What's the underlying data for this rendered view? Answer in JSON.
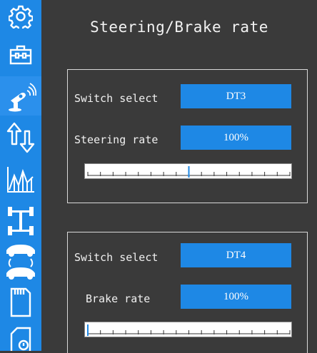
{
  "title": "Steering/Brake rate",
  "sidebar": {
    "items": [
      {
        "icon": "gear-icon"
      },
      {
        "icon": "toolbox-icon"
      },
      {
        "icon": "transmitter-icon",
        "active": true
      },
      {
        "icon": "reverse-arrows-icon"
      },
      {
        "icon": "curve-chart-icon"
      },
      {
        "icon": "chassis-icon"
      },
      {
        "icon": "car-mix-icon"
      },
      {
        "icon": "sd-card-icon"
      },
      {
        "icon": "info-card-icon"
      }
    ]
  },
  "steering": {
    "switch_label": "Switch select",
    "switch_value": "DT3",
    "rate_label": "Steering rate",
    "rate_value": "100%",
    "slider_position": 0.5
  },
  "brake": {
    "switch_label": "Switch select",
    "switch_value": "DT4",
    "rate_label": "Brake rate",
    "rate_value": "100%",
    "slider_position": 0.0
  },
  "colors": {
    "accent": "#1e88e5",
    "background": "#3a3a3a",
    "text": "#f0f0f0"
  }
}
